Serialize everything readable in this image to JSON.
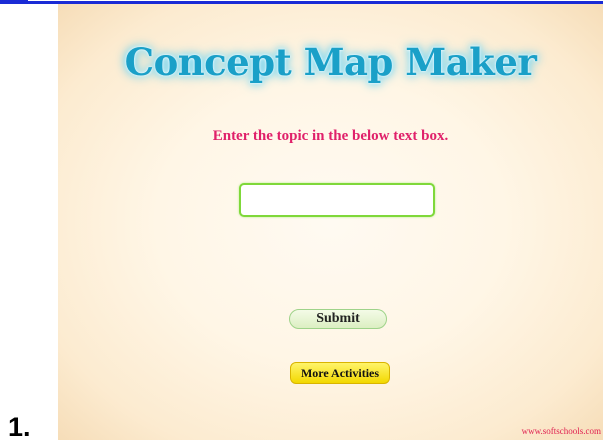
{
  "app": {
    "title": "Concept Map Maker",
    "instruction": "Enter the topic in the below text box.",
    "topic_input": {
      "value": "",
      "placeholder": ""
    },
    "submit_label": "Submit",
    "more_activities_label": "More Activities",
    "credit": "www.softschools.com"
  },
  "page": {
    "number": "1."
  },
  "colors": {
    "title": "#1aa0c8",
    "instruction": "#e0206a",
    "input_border": "#7fd83a",
    "more_button": "#f2d800",
    "top_line": "#1a2bd6"
  }
}
